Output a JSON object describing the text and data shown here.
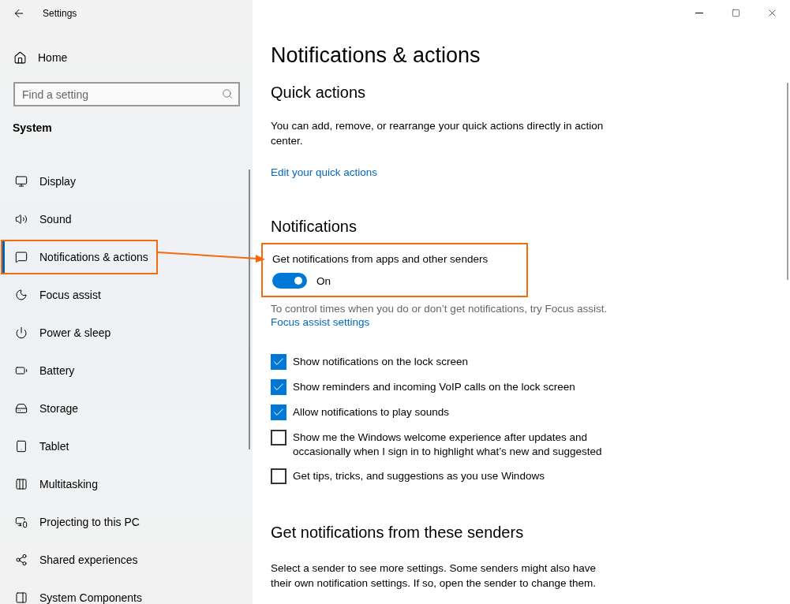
{
  "window": {
    "title": "Settings"
  },
  "sidebar": {
    "home": "Home",
    "search": {
      "placeholder": "Find a setting"
    },
    "section": "System",
    "items": [
      {
        "label": "Display",
        "selected": false
      },
      {
        "label": "Sound",
        "selected": false
      },
      {
        "label": "Notifications & actions",
        "selected": true
      },
      {
        "label": "Focus assist",
        "selected": false
      },
      {
        "label": "Power & sleep",
        "selected": false
      },
      {
        "label": "Battery",
        "selected": false
      },
      {
        "label": "Storage",
        "selected": false
      },
      {
        "label": "Tablet",
        "selected": false
      },
      {
        "label": "Multitasking",
        "selected": false
      },
      {
        "label": "Projecting to this PC",
        "selected": false
      },
      {
        "label": "Shared experiences",
        "selected": false
      },
      {
        "label": "System Components",
        "selected": false
      }
    ]
  },
  "page_title": "Notifications & actions",
  "quick_actions": {
    "heading": "Quick actions",
    "description": "You can add, remove, or rearrange your quick actions directly in action center.",
    "link": "Edit your quick actions"
  },
  "notifications": {
    "heading": "Notifications",
    "toggle": {
      "label": "Get notifications from apps and other senders",
      "on": true,
      "state_text": "On"
    },
    "hint": "To control times when you do or don’t get notifications, try Focus assist.",
    "link": "Focus assist settings",
    "options": [
      {
        "label": "Show notifications on the lock screen",
        "checked": true
      },
      {
        "label": "Show reminders and incoming VoIP calls on the lock screen",
        "checked": true
      },
      {
        "label": "Allow notifications to play sounds",
        "checked": true
      },
      {
        "label": "Show me the Windows welcome experience after updates and occasionally when I sign in to highlight what’s new and suggested",
        "checked": false
      },
      {
        "label": "Get tips, tricks, and suggestions as you use Windows",
        "checked": false
      }
    ]
  },
  "senders": {
    "heading": "Get notifications from these senders",
    "description": "Select a sender to see more settings. Some senders might also have their own notification settings. If so, open the sender to change them."
  }
}
